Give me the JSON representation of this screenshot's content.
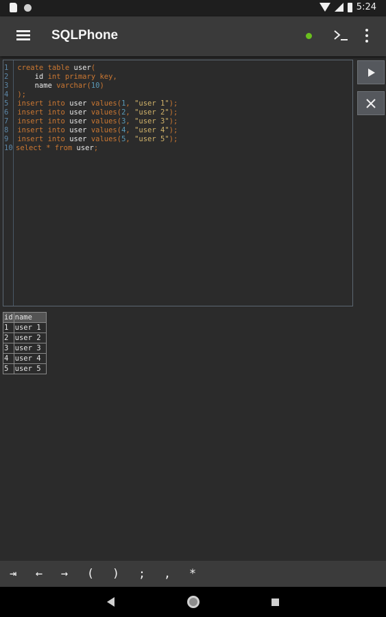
{
  "status_bar": {
    "time": "5:24"
  },
  "app_bar": {
    "title": "SQLPhone"
  },
  "editor": {
    "lines": [
      {
        "n": "1",
        "tokens": [
          [
            "kw",
            "create "
          ],
          [
            "kw",
            "table "
          ],
          [
            "id",
            "user"
          ],
          [
            "pun",
            "("
          ]
        ]
      },
      {
        "n": "2",
        "tokens": [
          [
            "id",
            "    id "
          ],
          [
            "kw",
            "int "
          ],
          [
            "kw",
            "primary "
          ],
          [
            "kw",
            "key"
          ],
          [
            "pun",
            ","
          ]
        ]
      },
      {
        "n": "3",
        "tokens": [
          [
            "id",
            "    name "
          ],
          [
            "kw",
            "varchar"
          ],
          [
            "pun",
            "("
          ],
          [
            "num",
            "10"
          ],
          [
            "pun",
            ")"
          ]
        ]
      },
      {
        "n": "4",
        "tokens": [
          [
            "pun",
            ");"
          ]
        ]
      },
      {
        "n": "5",
        "tokens": [
          [
            "kw",
            "insert "
          ],
          [
            "kw",
            "into "
          ],
          [
            "id",
            "user "
          ],
          [
            "kw",
            "values"
          ],
          [
            "pun",
            "("
          ],
          [
            "num",
            "1"
          ],
          [
            "pun",
            ", "
          ],
          [
            "str",
            "\"user 1\""
          ],
          [
            "pun",
            ");"
          ]
        ]
      },
      {
        "n": "6",
        "tokens": [
          [
            "kw",
            "insert "
          ],
          [
            "kw",
            "into "
          ],
          [
            "id",
            "user "
          ],
          [
            "kw",
            "values"
          ],
          [
            "pun",
            "("
          ],
          [
            "num",
            "2"
          ],
          [
            "pun",
            ", "
          ],
          [
            "str",
            "\"user 2\""
          ],
          [
            "pun",
            ");"
          ]
        ]
      },
      {
        "n": "7",
        "tokens": [
          [
            "kw",
            "insert "
          ],
          [
            "kw",
            "into "
          ],
          [
            "id",
            "user "
          ],
          [
            "kw",
            "values"
          ],
          [
            "pun",
            "("
          ],
          [
            "num",
            "3"
          ],
          [
            "pun",
            ", "
          ],
          [
            "str",
            "\"user 3\""
          ],
          [
            "pun",
            ");"
          ]
        ]
      },
      {
        "n": "8",
        "tokens": [
          [
            "kw",
            "insert "
          ],
          [
            "kw",
            "into "
          ],
          [
            "id",
            "user "
          ],
          [
            "kw",
            "values"
          ],
          [
            "pun",
            "("
          ],
          [
            "num",
            "4"
          ],
          [
            "pun",
            ", "
          ],
          [
            "str",
            "\"user 4\""
          ],
          [
            "pun",
            ");"
          ]
        ]
      },
      {
        "n": "9",
        "tokens": [
          [
            "kw",
            "insert "
          ],
          [
            "kw",
            "into "
          ],
          [
            "id",
            "user "
          ],
          [
            "kw",
            "values"
          ],
          [
            "pun",
            "("
          ],
          [
            "num",
            "5"
          ],
          [
            "pun",
            ", "
          ],
          [
            "str",
            "\"user 5\""
          ],
          [
            "pun",
            ");"
          ]
        ]
      },
      {
        "n": "10",
        "tokens": [
          [
            "kw",
            "select "
          ],
          [
            "kw",
            "* "
          ],
          [
            "kw",
            "from "
          ],
          [
            "id",
            "user"
          ],
          [
            "pun",
            ";"
          ]
        ]
      }
    ]
  },
  "side_buttons": {
    "run_icon": "play-icon",
    "clear_icon": "close-icon"
  },
  "result": {
    "columns": [
      "id",
      "name"
    ],
    "rows": [
      [
        "1",
        "user 1"
      ],
      [
        "2",
        "user 2"
      ],
      [
        "3",
        "user 3"
      ],
      [
        "4",
        "user 4"
      ],
      [
        "5",
        "user 5"
      ]
    ]
  },
  "keybar": {
    "keys": [
      "⇥",
      "←",
      "→",
      "(",
      ")",
      ";",
      ",",
      "*"
    ]
  },
  "colors": {
    "keyword": "#cc7832",
    "number": "#5a9bb8",
    "string": "#d1b36a",
    "connected_indicator": "#6abf1e"
  }
}
